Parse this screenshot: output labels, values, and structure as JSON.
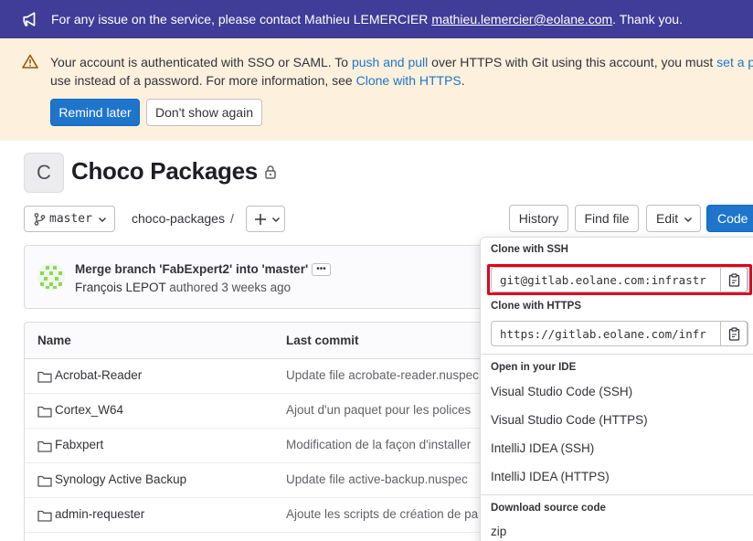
{
  "broadcast": {
    "text": "For any issue on the service, please contact Mathieu LEMERCIER ",
    "email": "mathieu.lemercier@eolane.com",
    "tail": ". Thank you."
  },
  "alert": {
    "line1_a": "Your account is authenticated with SSO or SAML. To ",
    "line1_link1": "push and pull",
    "line1_b": " over HTTPS with Git using this account, you must ",
    "line1_link2": "set a pass",
    "line2_a": "use instead of a password. For more information, see ",
    "line2_link": "Clone with HTTPS",
    "line2_b": ".",
    "remind_label": "Remind later",
    "dont_show_label": "Don't show again"
  },
  "project": {
    "avatar_letter": "C",
    "title": "Choco Packages"
  },
  "toolbar": {
    "branch": "master",
    "breadcrumb_path": "choco-packages",
    "breadcrumb_sep": "/",
    "history_label": "History",
    "find_file_label": "Find file",
    "edit_label": "Edit",
    "code_label": "Code"
  },
  "commit": {
    "title": "Merge branch 'FabExpert2' into 'master'",
    "ellipsis": "•••",
    "author": "François LEPOT",
    "action": " authored ",
    "time": "3 weeks ago"
  },
  "files": {
    "col_name": "Name",
    "col_commit": "Last commit",
    "rows": [
      {
        "name": "Acrobat-Reader",
        "message": "Update file acrobate-reader.nuspec"
      },
      {
        "name": "Cortex_W64",
        "message": "Ajout d'un paquet pour les polices"
      },
      {
        "name": "Fabxpert",
        "message": "Modification de la façon d'installer"
      },
      {
        "name": "Synology Active Backup",
        "message": "Update file active-backup.nuspec"
      },
      {
        "name": "admin-requester",
        "message": "Ajoute les scripts de création de pa"
      }
    ]
  },
  "clone_dropdown": {
    "ssh_label": "Clone with SSH",
    "ssh_url": "git@gitlab.eolane.com:infrastr",
    "https_label": "Clone with HTTPS",
    "https_url": "https://gitlab.eolane.com/infr",
    "ide_label": "Open in your IDE",
    "ide_items": [
      "Visual Studio Code (SSH)",
      "Visual Studio Code (HTTPS)",
      "IntelliJ IDEA (SSH)",
      "IntelliJ IDEA (HTTPS)"
    ],
    "download_label": "Download source code",
    "download_first": "zip"
  },
  "colors": {
    "broadcast_bg": "#3f3d97",
    "alert_bg": "#fdf1dd",
    "primary": "#1f75cb",
    "highlight": "#e0001b"
  }
}
